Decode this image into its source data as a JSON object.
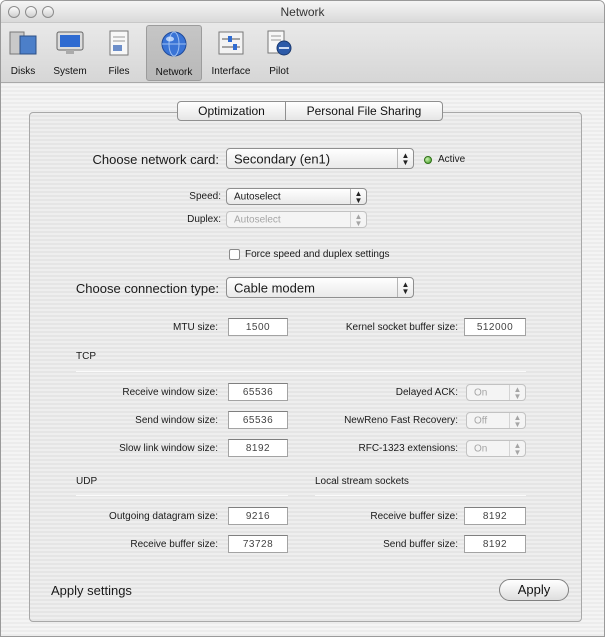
{
  "window": {
    "title": "Network"
  },
  "toolbar": {
    "items": [
      {
        "label": "Disks",
        "icon": "disks-icon"
      },
      {
        "label": "System",
        "icon": "system-icon"
      },
      {
        "label": "Files",
        "icon": "files-icon"
      },
      {
        "label": "Network",
        "icon": "network-globe-icon",
        "selected": true
      },
      {
        "label": "Interface",
        "icon": "interface-sliders-icon"
      },
      {
        "label": "Pilot",
        "icon": "pilot-icon"
      }
    ]
  },
  "tabs": [
    {
      "label": "Optimization",
      "selected": true
    },
    {
      "label": "Personal File Sharing",
      "selected": false
    }
  ],
  "network_card": {
    "label": "Choose network card:",
    "value": "Secondary (en1)",
    "status": "Active",
    "status_color": "#3e9b1e"
  },
  "speed": {
    "label": "Speed:",
    "value": "Autoselect"
  },
  "duplex": {
    "label": "Duplex:",
    "value": "Autoselect",
    "enabled": false
  },
  "force_checkbox": {
    "label": "Force speed and duplex settings",
    "checked": false
  },
  "connection_type": {
    "label": "Choose connection type:",
    "value": "Cable modem"
  },
  "mtu": {
    "label": "MTU size:",
    "value": "1500"
  },
  "kernel_buffer": {
    "label": "Kernel socket buffer size:",
    "value": "512000"
  },
  "tcp": {
    "heading": "TCP",
    "receive_window": {
      "label": "Receive window size:",
      "value": "65536"
    },
    "send_window": {
      "label": "Send window size:",
      "value": "65536"
    },
    "slow_link_window": {
      "label": "Slow link window size:",
      "value": "8192"
    },
    "delayed_ack": {
      "label": "Delayed ACK:",
      "value": "On"
    },
    "newreno": {
      "label": "NewReno Fast Recovery:",
      "value": "Off"
    },
    "rfc1323": {
      "label": "RFC-1323 extensions:",
      "value": "On"
    }
  },
  "udp": {
    "heading": "UDP",
    "outgoing_datagram": {
      "label": "Outgoing datagram size:",
      "value": "9216"
    },
    "receive_buffer": {
      "label": "Receive buffer size:",
      "value": "73728"
    }
  },
  "local_stream": {
    "heading": "Local stream sockets",
    "receive_buffer": {
      "label": "Receive buffer size:",
      "value": "8192"
    },
    "send_buffer": {
      "label": "Send buffer size:",
      "value": "8192"
    }
  },
  "footer": {
    "label": "Apply settings",
    "apply_button": "Apply"
  }
}
